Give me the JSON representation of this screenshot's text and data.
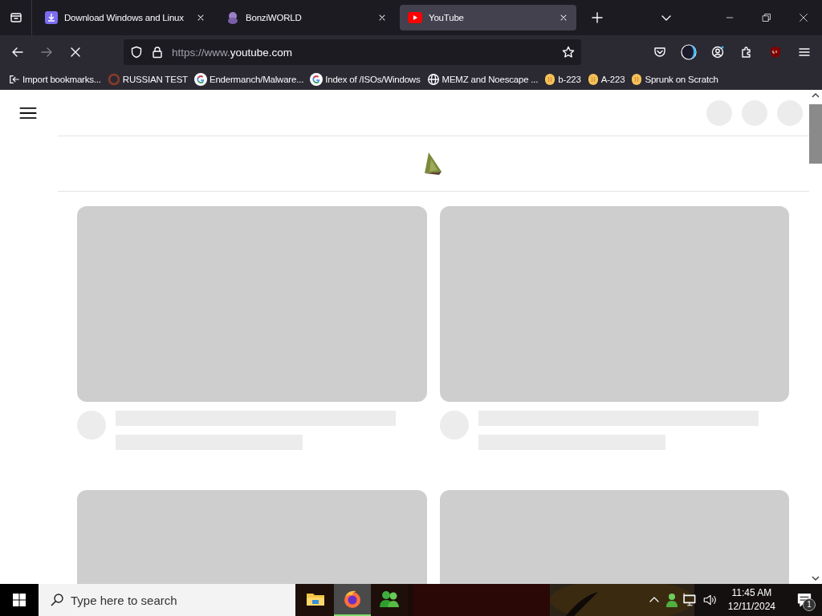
{
  "tabs": [
    {
      "title": "Download Windows and Linux",
      "kind": "download",
      "selected": false
    },
    {
      "title": "BonziWORLD",
      "kind": "figure",
      "selected": false
    },
    {
      "title": "YouTube",
      "kind": "video",
      "selected": true
    }
  ],
  "toolbar": {
    "url_prefix": "https://www.",
    "url_host": "youtube.com",
    "loading": true,
    "forward_disabled": true
  },
  "bookmarks": [
    {
      "label": "Import bookmarks...",
      "kind": "import"
    },
    {
      "label": "RUSSIAN TEST",
      "kind": "ring"
    },
    {
      "label": "Endermanch/Malware...",
      "kind": "google"
    },
    {
      "label": "Index of /ISOs/Windows",
      "kind": "google"
    },
    {
      "label": "MEMZ and Noescape ...",
      "kind": "globe"
    },
    {
      "label": "b-223",
      "kind": "scratch"
    },
    {
      "label": "A-223",
      "kind": "scratch"
    },
    {
      "label": "Sprunk on Scratch",
      "kind": "scratch"
    }
  ],
  "video_grid": [
    {
      "kind": "placeholder"
    },
    {
      "kind": "placeholder"
    },
    {
      "kind": "placeholder"
    },
    {
      "kind": "placeholder"
    }
  ],
  "taskbar": {
    "search_placeholder": "Type here to search",
    "apps": [
      {
        "kind": "folder",
        "active": false
      },
      {
        "kind": "firefox",
        "active": true
      },
      {
        "kind": "people",
        "active": false
      }
    ],
    "time": "11:45 AM",
    "date": "12/11/2024",
    "notification_count": "1"
  }
}
